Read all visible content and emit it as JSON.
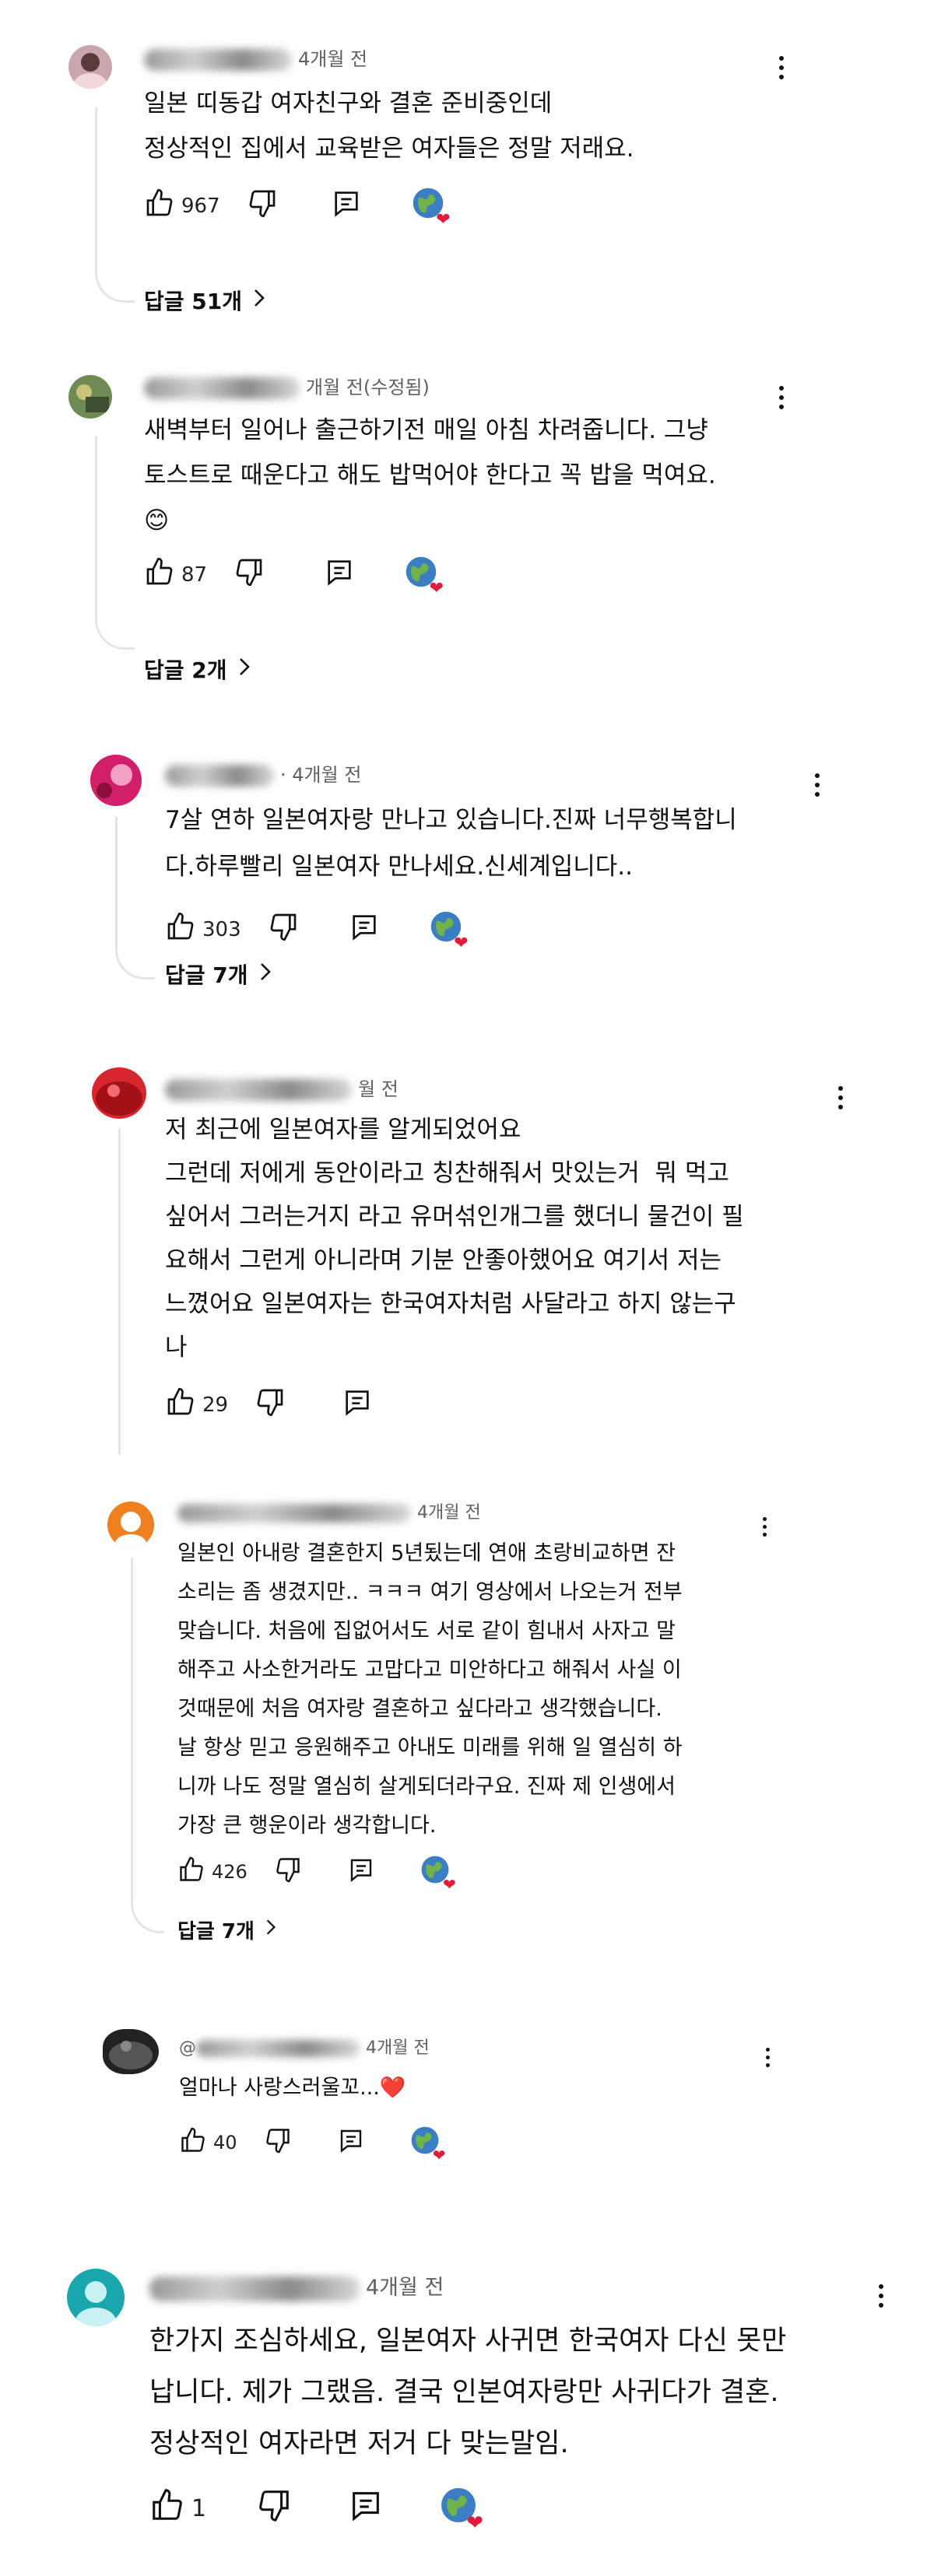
{
  "comments": [
    {
      "author": "",
      "time": "4개월 전",
      "edited": "",
      "lines": "일본 띠동갑 여자친구와 결혼 준비중인데\n정상적인 집에서 교육받은 여자들은 정말 저래요.",
      "likes": "967",
      "replies": "답글 51개"
    },
    {
      "author": "",
      "time": "개월 전",
      "edited": "(수정됨)",
      "lines": "새벽부터 일어나 출근하기전 매일 아침 차려줍니다. 그냥\n토스트로 때운다고 해도 밥먹어야 한다고 꼭 밥을 먹여요.\n😊",
      "likes": "87",
      "replies": "답글 2개"
    },
    {
      "author": "",
      "time": "· 4개월 전",
      "edited": "",
      "lines": "7살 연하 일본여자랑 만나고 있습니다.진짜 너무행복합니\n다.하루빨리 일본여자 만나세요.신세계입니다..",
      "likes": "303",
      "replies": "답글 7개"
    },
    {
      "author": "",
      "time": "월 전",
      "edited": "",
      "lines": "저 최근에 일본여자를 알게되었어요\n그런데 저에게 동안이라고 칭찬해줘서 맛있는거  뭐 먹고\n싶어서 그러는거지 라고 유머섞인개그를 했더니 물건이 필\n요해서 그런게 아니라며 기분 안좋아했어요 여기서 저는\n느꼈어요 일본여자는 한국여자처럼 사달라고 하지 않는구\n나",
      "likes": "29",
      "replies": ""
    },
    {
      "author": "",
      "time": "4개월 전",
      "edited": "",
      "lines": "일본인 아내랑 결혼한지 5년됬는데 연애 초랑비교하면 잔\n소리는 좀 생겼지만.. ㅋㅋㅋ 여기 영상에서 나오는거 전부\n맞습니다. 처음에 집없어서도 서로 같이 힘내서 사자고 말\n해주고 사소한거라도 고맙다고 미안하다고 해줘서 사실 이\n것때문에 처음 여자랑 결혼하고 싶다라고 생각했습니다.\n날 항상 믿고 응원해주고 아내도 미래를 위해 일 열심히 하\n니까 나도 정말 열심히 살게되더라구요. 진짜 제 인생에서\n가장 큰 행운이라 생각합니다.",
      "likes": "426",
      "replies": "답글 7개"
    },
    {
      "author": "@",
      "time": "4개월 전",
      "edited": "",
      "lines": "얼마나 사랑스러울꼬...❤️",
      "likes": "40",
      "replies": ""
    },
    {
      "author": "",
      "time": "4개월 전",
      "edited": "",
      "lines": "한가지 조심하세요, 일본여자 사귀면 한국여자 다신 못만\n납니다. 제가 그랬음. 결국 인본여자랑만 사귀다가 결혼.\n정상적인 여자라면 저거 다 맞는말임.",
      "likes": "1",
      "replies": ""
    }
  ],
  "colors": {
    "avatar_0": "#c9a6ae",
    "avatar_1": "#6f8a52",
    "avatar_2": "#d21f6a",
    "avatar_3": "#d8262e",
    "avatar_4": "#f07f1f",
    "avatar_5": "#222222",
    "avatar_6": "#1aa6ad",
    "heart": "#e21b3c",
    "thread_line": "#e5e5e5"
  },
  "icons": {
    "like": "thumbs-up-icon",
    "dislike": "thumbs-down-icon",
    "reply": "reply-icon",
    "creator_heart": "globe-heart-icon",
    "menu": "more-vert-icon",
    "expand": "chevron-right-icon"
  }
}
